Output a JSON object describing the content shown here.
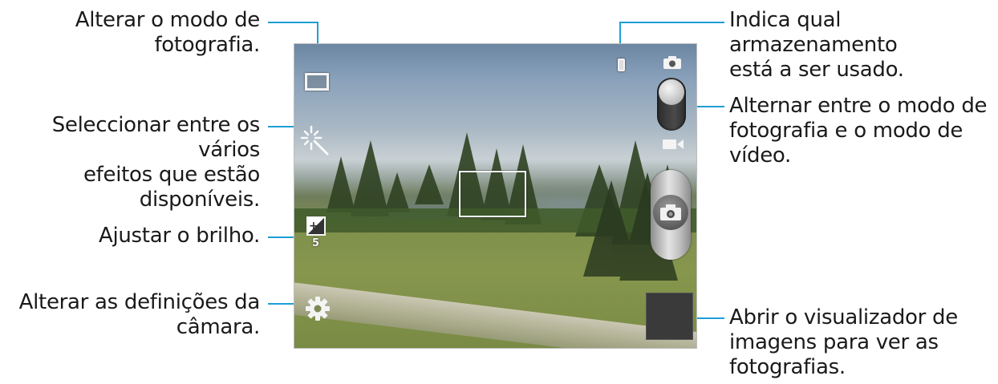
{
  "callouts": {
    "photo_mode": "Alterar o modo de\nfotografia.",
    "effects": "Seleccionar entre os vários\nefeitos que estão\ndisponíveis.",
    "brightness": "Ajustar o brilho.",
    "settings": "Alterar as definições da\ncâmara.",
    "storage": "Indica qual armazenamento\nestá a ser usado.",
    "switch_mode": "Alternar entre o modo de\nfotografia e o modo de\nvídeo.",
    "gallery": "Abrir o visualizador de\nimagens para ver as\nfotografias."
  },
  "camera": {
    "brightness_value": "5",
    "icons": {
      "photo_mode": "shooting-mode-icon",
      "effects": "effects-icon",
      "brightness": "exposure-icon",
      "settings": "gear-icon",
      "storage": "phone-storage-icon",
      "photo": "camera-icon",
      "video": "video-camera-icon",
      "shutter": "shutter-camera-icon"
    }
  },
  "colors": {
    "callout_line": "#1e9fd6"
  }
}
